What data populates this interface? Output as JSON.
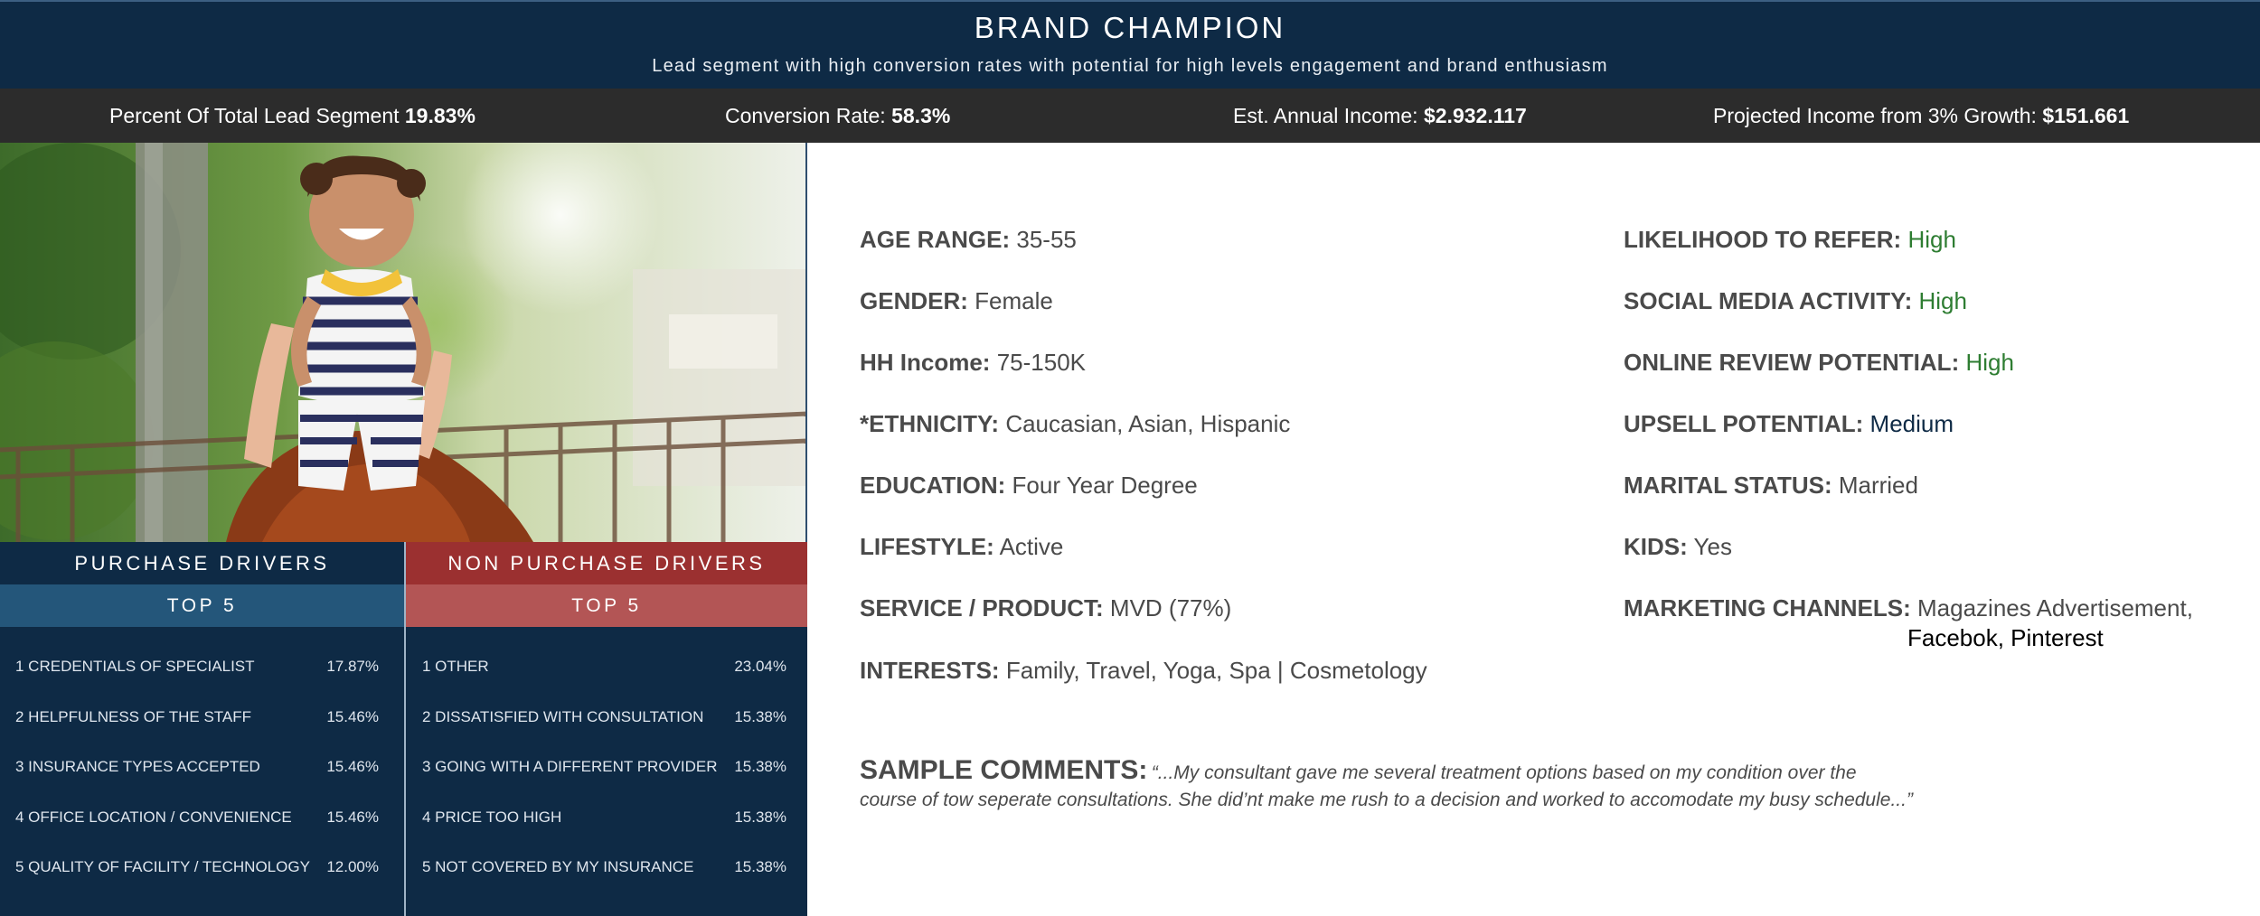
{
  "header": {
    "title": "BRAND CHAMPION",
    "subtitle": "Lead segment with high conversion rates with potential for high levels engagement and brand enthusiasm"
  },
  "stats": [
    {
      "label": "Percent Of Total Lead Segment",
      "value": "19.83%"
    },
    {
      "label": "Conversion Rate:",
      "value": "58.3%"
    },
    {
      "label": "Est. Annual Income:",
      "value": "$2.932.117"
    },
    {
      "label": "Projected Income from 3% Growth:",
      "value": "$151.661"
    }
  ],
  "purchase_drivers": {
    "heading": "PURCHASE DRIVERS",
    "sub": "TOP 5",
    "items": [
      {
        "label": "1 CREDENTIALS OF SPECIALIST",
        "pct": "17.87%"
      },
      {
        "label": "2 HELPFULNESS OF THE STAFF",
        "pct": "15.46%"
      },
      {
        "label": "3 INSURANCE TYPES ACCEPTED",
        "pct": "15.46%"
      },
      {
        "label": "4 OFFICE LOCATION /  CONVENIENCE",
        "pct": "15.46%"
      },
      {
        "label": "5 QUALITY OF FACILITY / TECHNOLOGY",
        "pct": "12.00%"
      }
    ]
  },
  "non_purchase_drivers": {
    "heading": "NON PURCHASE DRIVERS",
    "sub": "TOP 5",
    "items": [
      {
        "label": "1  OTHER",
        "pct": "23.04%"
      },
      {
        "label": "2  DISSATISFIED WITH CONSULTATION",
        "pct": "15.38%"
      },
      {
        "label": "3 GOING WITH A DIFFERENT PROVIDER",
        "pct": "15.38%"
      },
      {
        "label": "4 PRICE TOO HIGH",
        "pct": "15.38%"
      },
      {
        "label": "5  NOT COVERED BY MY INSURANCE",
        "pct": "15.38%"
      }
    ]
  },
  "profile_left": [
    {
      "key": "AGE RANGE:",
      "value": "35-55"
    },
    {
      "key": "GENDER:",
      "value": "Female"
    },
    {
      "key": "HH Income:",
      "value": "75-150K"
    },
    {
      "key": "*ETHNICITY:",
      "value": "Caucasian, Asian, Hispanic"
    },
    {
      "key": "EDUCATION:",
      "value": "Four Year Degree"
    },
    {
      "key": "LIFESTYLE:",
      "value": "Active"
    },
    {
      "key": "SERVICE / PRODUCT:",
      "value": "MVD (77%)"
    },
    {
      "key": "INTERESTS:",
      "value": "Family, Travel, Yoga, Spa | Cosmetology"
    }
  ],
  "profile_right": [
    {
      "key": "LIKELIHOOD TO REFER:",
      "value": "High"
    },
    {
      "key": "SOCIAL MEDIA ACTIVITY:",
      "value": "High"
    },
    {
      "key": "ONLINE REVIEW POTENTIAL:",
      "value": "High"
    },
    {
      "key": "UPSELL POTENTIAL:",
      "value": "Medium"
    },
    {
      "key": "MARITAL STATUS:",
      "value": "Married"
    },
    {
      "key": "KIDS:",
      "value": "Yes"
    },
    {
      "key": "MARKETING CHANNELS:",
      "value": "Magazines Advertisement,",
      "value2": "Facebok, Pinterest"
    }
  ],
  "comments": {
    "label": "SAMPLE COMMENTS:",
    "line1": "“...My consultant gave me several treatment options based on my condition over the",
    "line2": "course of tow seperate consultations. She did’nt make me rush to a decision and worked to accomodate my busy schedule...”"
  },
  "colors": {
    "navy": "#0e2a45",
    "dark_bar": "#2c2c2c",
    "red": "#9b3030",
    "green": "#2e7d32"
  }
}
